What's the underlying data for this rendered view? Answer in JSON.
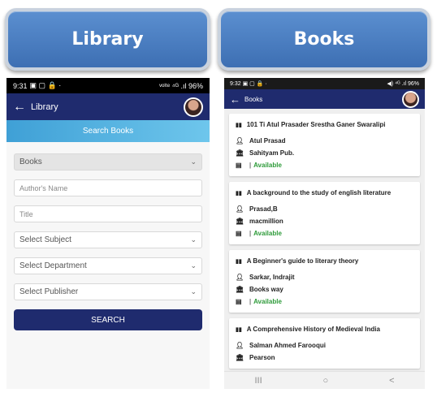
{
  "banners": {
    "left": "Library",
    "right": "Books"
  },
  "left_phone": {
    "status": {
      "time": "9:31",
      "icons": "▣ ▢ 🔒 ·",
      "right": "ᵛᵒˡᵗᵉ ⁴ᴳ .ıl 96%"
    },
    "appbar": {
      "title": "Library"
    },
    "search_header": "Search Books",
    "form": {
      "type_select": "Books",
      "author_placeholder": "Author's Name",
      "title_placeholder": "Title",
      "subject_select": "Select Subject",
      "department_select": "Select Department",
      "publisher_select": "Select Publisher",
      "search_button": "SEARCH"
    }
  },
  "right_phone": {
    "status": {
      "time": "9:32",
      "icons": "▣ ▢ 🔒 ·",
      "right": "◀) ⁴ᴳ .ıl 96%"
    },
    "appbar": {
      "title": "Books"
    },
    "books": [
      {
        "title": "101 Ti Atul Prasader Srestha Ganer Swaralipi",
        "author": "Atul Prasad",
        "publisher": "Sahityam Pub.",
        "status": "Available"
      },
      {
        "title": "A background to the study of english literature",
        "author": "Prasad,B",
        "publisher": "macmillion",
        "status": "Available"
      },
      {
        "title": "A Beginner's guide to literary theory",
        "author": "Sarkar, Indrajit",
        "publisher": "Books way",
        "status": "Available"
      },
      {
        "title": "A Comprehensive History of Medieval India",
        "author": "Salman Ahmed Farooqui",
        "publisher": "Pearson",
        "status": ""
      }
    ],
    "nav": {
      "recents": "III",
      "home": "○",
      "back": "<"
    }
  },
  "colors": {
    "appbar": "#1f2b6e",
    "banner": "#4a7cc0",
    "available": "#2e9b3a",
    "search_header": "#4fb0e0"
  },
  "icons": {
    "book": "book-icon",
    "author": "person-icon",
    "publisher": "bank-icon",
    "status": "archive-icon"
  }
}
